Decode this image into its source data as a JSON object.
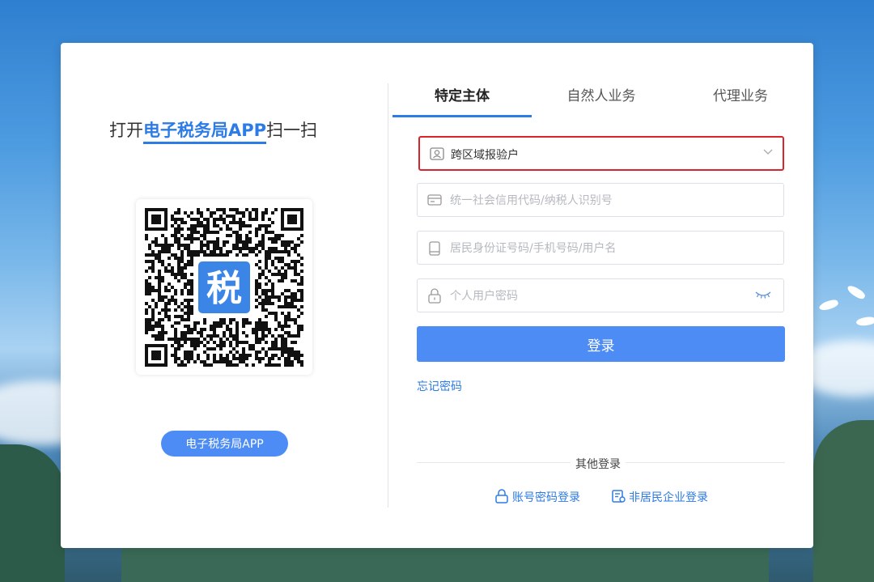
{
  "left": {
    "title_prefix": "打开",
    "title_highlight": "电子税务局APP",
    "title_suffix": "扫一扫",
    "qr_center_char": "税",
    "app_button": "电子税务局APP"
  },
  "tabs": [
    "特定主体",
    "自然人业务",
    "代理业务"
  ],
  "form": {
    "select_value": "跨区域报验户",
    "credit_code_placeholder": "统一社会信用代码/纳税人识别号",
    "id_placeholder": "居民身份证号码/手机号码/用户名",
    "password_placeholder": "个人用户密码",
    "login_button": "登录",
    "forgot_password": "忘记密码"
  },
  "other": {
    "title": "其他登录",
    "account_login": "账号密码登录",
    "non_resident_login": "非居民企业登录"
  },
  "colors": {
    "accent": "#2d7be5",
    "button": "#4d8cf5",
    "highlight_border": "#d9232d"
  }
}
